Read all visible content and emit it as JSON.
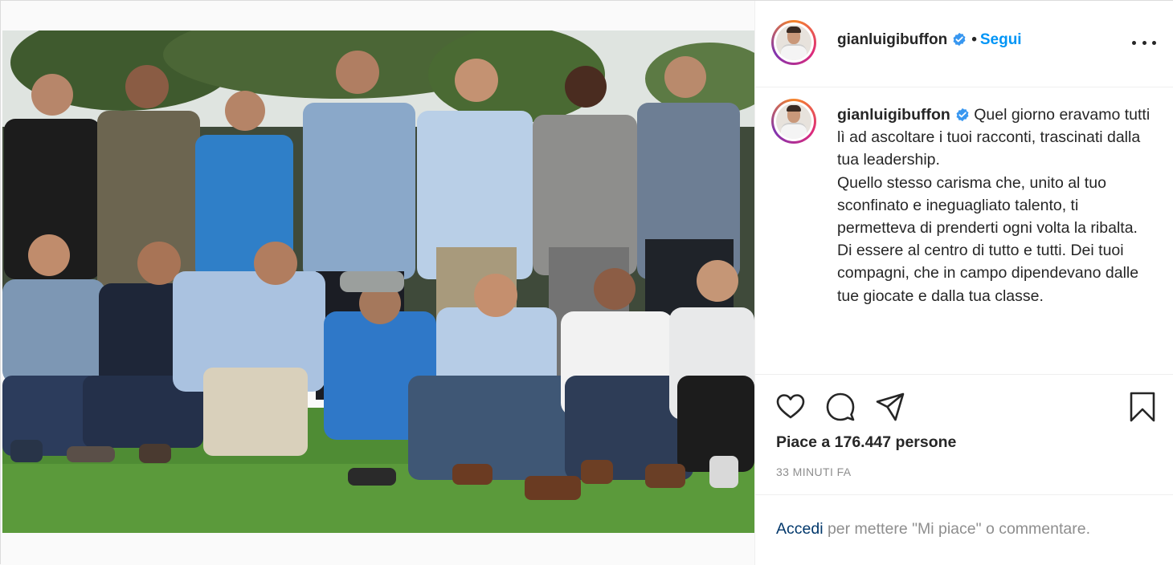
{
  "profile": {
    "username": "gianluigibuffon",
    "verified": true,
    "follow_label": "Segui",
    "separator": "•"
  },
  "caption": {
    "username": "gianluigibuffon",
    "lines": [
      "Quel giorno eravamo tutti lì ad ascoltare i tuoi racconti, trascinati dalla tua leadership.",
      "Quello stesso carisma che, unito al tuo sconfinato e ineguagliato talento, ti permetteva di prenderti ogni volta la ribalta.",
      "Di essere al centro di tutto e tutti. Dei tuoi compagni, che in campo dipendevano dalle tue giocate e dalla tua classe."
    ]
  },
  "actions": {
    "like_icon": "heart-icon",
    "comment_icon": "comment-icon",
    "share_icon": "share-icon",
    "save_icon": "bookmark-icon"
  },
  "likes_text": "Piace a 176.447 persone",
  "timestamp": "33 MINUTI FA",
  "login_prompt": {
    "link": "Accedi",
    "rest": " per mettere \"Mi piace\" o commentare."
  },
  "colors": {
    "link_blue": "#0095f6",
    "verified_blue": "#3897f0",
    "text_primary": "#262626",
    "text_secondary": "#8e8e8e"
  }
}
